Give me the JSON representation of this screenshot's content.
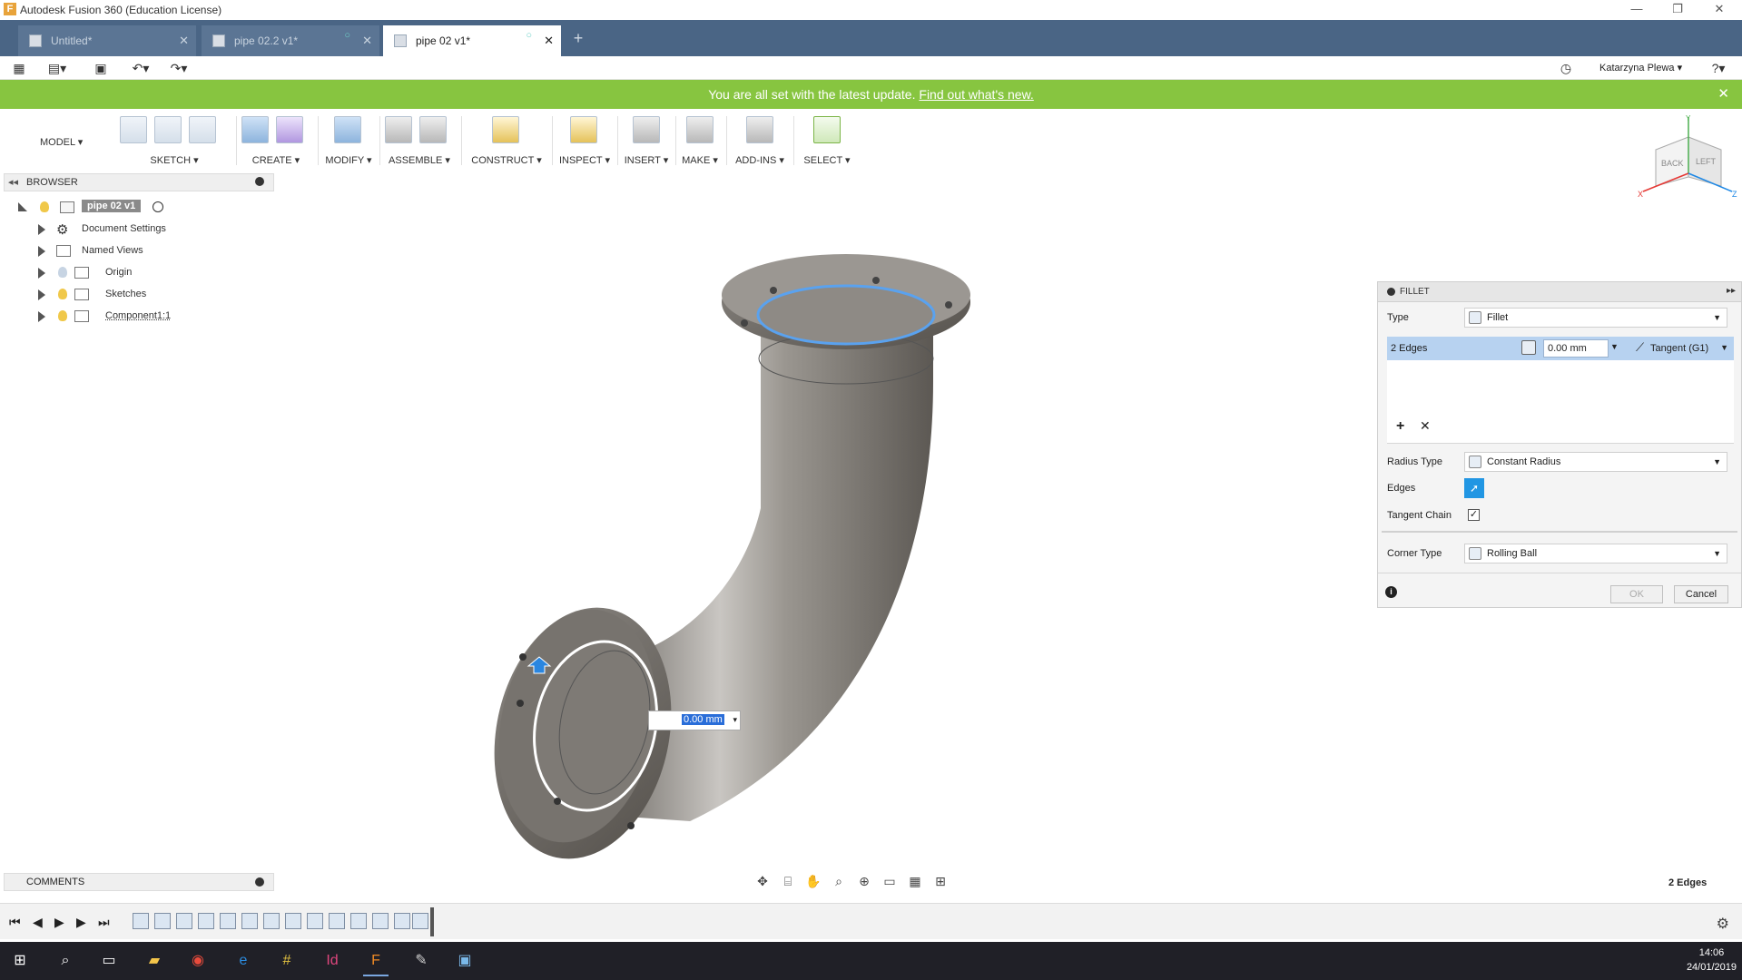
{
  "window": {
    "title": "Autodesk Fusion 360 (Education License)",
    "icon_letter": "F"
  },
  "tabs": [
    {
      "label": "Untitled*"
    },
    {
      "label": "pipe 02.2 v1*"
    },
    {
      "label": "pipe 02 v1*"
    }
  ],
  "quick": {
    "user": "Katarzyna Plewa ▾"
  },
  "banner": {
    "text": "You are all set with the latest update. ",
    "link": "Find out what's new."
  },
  "toolbar": {
    "workspace": "MODEL ▾",
    "groups": [
      "SKETCH ▾",
      "CREATE ▾",
      "MODIFY ▾",
      "ASSEMBLE ▾",
      "CONSTRUCT ▾",
      "INSPECT ▾",
      "INSERT ▾",
      "MAKE ▾",
      "ADD-INS ▾",
      "SELECT ▾"
    ]
  },
  "browser": {
    "title": "BROWSER",
    "root": "pipe 02 v1",
    "items": [
      "Document Settings",
      "Named Views",
      "Origin",
      "Sketches",
      "Component1:1"
    ]
  },
  "viewcube": {
    "back": "BACK",
    "left": "LEFT",
    "x": "X",
    "y": "Y",
    "z": "Z"
  },
  "fillet": {
    "title": "FILLET",
    "type_label": "Type",
    "type_value": "Fillet",
    "edges_count": "2 Edges",
    "radius": "0.00 mm",
    "continuity": "Tangent (G1)",
    "radius_type_label": "Radius Type",
    "radius_type_value": "Constant Radius",
    "edges_label": "Edges",
    "tangent_chain_label": "Tangent Chain",
    "corner_type_label": "Corner Type",
    "corner_type_value": "Rolling Ball",
    "ok": "OK",
    "cancel": "Cancel"
  },
  "inline_value": "0.00 mm",
  "comments": {
    "title": "COMMENTS"
  },
  "status": {
    "selection": "2 Edges"
  },
  "clock": {
    "time": "14:06",
    "date": "24/01/2019"
  },
  "colors": {
    "banner": "#87c540",
    "tabstrip": "#4a6585",
    "selection": "#2196e3",
    "edge_highlight": "#5aa2ef"
  }
}
